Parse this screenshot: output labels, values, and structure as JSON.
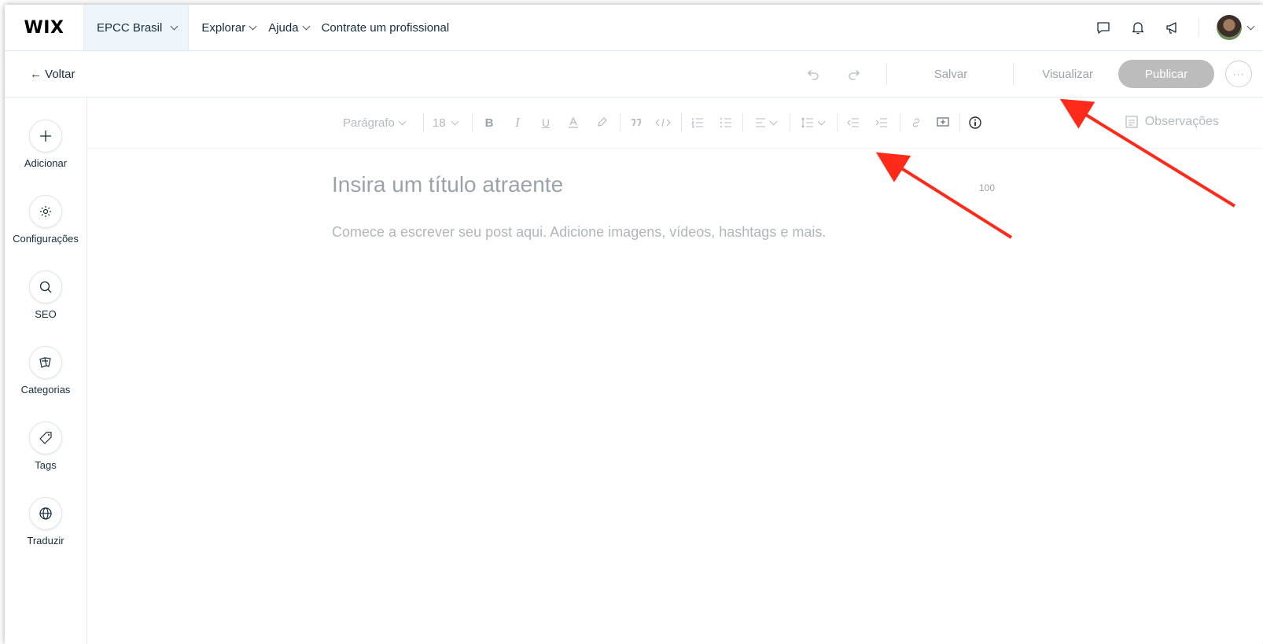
{
  "header": {
    "logo": "WIX",
    "site_name": "EPCC Brasil",
    "nav": [
      "Explorar",
      "Ajuda",
      "Contrate um profissional"
    ],
    "icons": [
      "chat-icon",
      "bell-icon",
      "megaphone-icon"
    ]
  },
  "actionbar": {
    "back_label": "← Voltar",
    "save_label": "Salvar",
    "preview_label": "Visualizar",
    "publish_label": "Publicar",
    "more_label": "···"
  },
  "sidebar": {
    "items": [
      {
        "label": "Adicionar",
        "icon": "plus-icon"
      },
      {
        "label": "Configurações",
        "icon": "gear-icon"
      },
      {
        "label": "SEO",
        "icon": "search-icon"
      },
      {
        "label": "Categorias",
        "icon": "cards-icon"
      },
      {
        "label": "Tags",
        "icon": "tag-icon"
      },
      {
        "label": "Traduzir",
        "icon": "globe-icon"
      }
    ]
  },
  "toolbar": {
    "paragraph_label": "Parágrafo",
    "font_size": "18",
    "bold": "B",
    "italic": "I",
    "underline": "U",
    "notes_label": "Observações"
  },
  "editor": {
    "title_placeholder": "Insira um título atraente",
    "title_max_chars": "100",
    "body_placeholder": "Comece a escrever seu post aqui. Adicione imagens, vídeos, hashtags e mais."
  },
  "colors": {
    "annotation_arrow": "#ff2a1a",
    "publish_button": "#bcbcbc",
    "site_menu_bg": "#eef5fb"
  }
}
